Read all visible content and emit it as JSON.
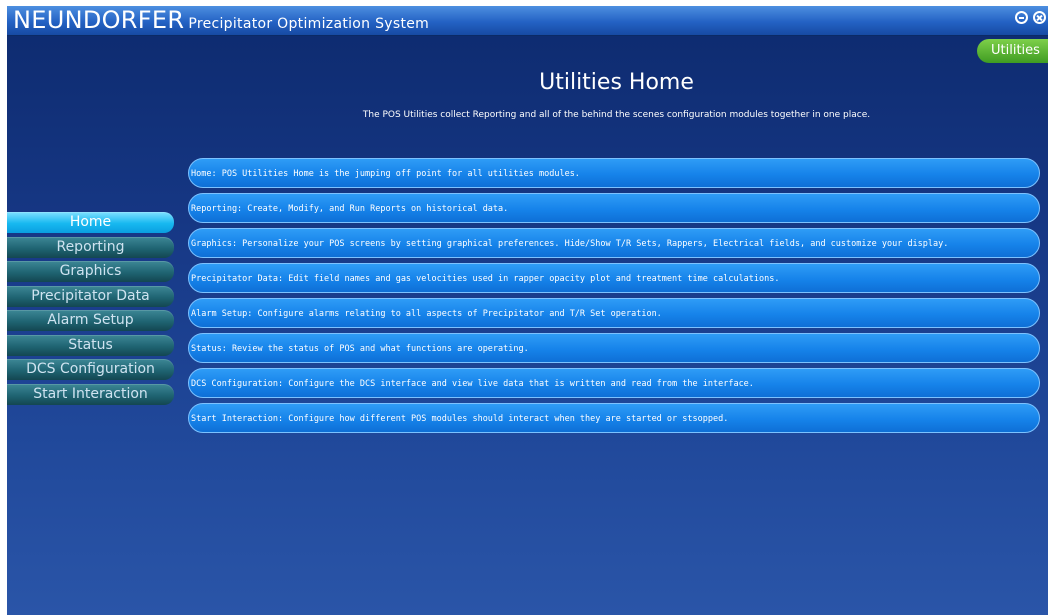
{
  "titlebar": {
    "brand": "NEUNDORFER",
    "subtitle": "Precipitator Optimization System",
    "minimize_icon": "minimize-circle-icon",
    "close_icon": "close-circle-icon"
  },
  "active_tab": "Utilities",
  "page": {
    "title": "Utilities Home",
    "description": "The POS Utilities collect Reporting and all of the behind the scenes configuration modules together in one place."
  },
  "sidebar": {
    "items": [
      {
        "label": "Home",
        "active": true
      },
      {
        "label": "Reporting",
        "active": false
      },
      {
        "label": "Graphics",
        "active": false
      },
      {
        "label": "Precipitator Data",
        "active": false
      },
      {
        "label": "Alarm Setup",
        "active": false
      },
      {
        "label": "Status",
        "active": false
      },
      {
        "label": "DCS Configuration",
        "active": false
      },
      {
        "label": "Start Interaction",
        "active": false
      }
    ]
  },
  "modules": [
    "Home: POS Utilities Home is the jumping off point for all utilities modules.",
    "Reporting: Create, Modify, and Run Reports on historical data.",
    "Graphics: Personalize your POS screens by setting graphical preferences. Hide/Show T/R Sets, Rappers, Electrical fields, and customize your display.",
    "Precipitator Data: Edit field names and gas velocities used in rapper opacity plot and treatment time calculations.",
    "Alarm Setup: Configure alarms relating to all aspects of Precipitator and T/R Set operation.",
    "Status: Review the status of POS and what functions are operating.",
    "DCS Configuration: Configure the DCS interface and view live data that is written and read from the interface.",
    "Start Interaction: Configure how different POS modules should interact when they are started or stsopped."
  ],
  "colors": {
    "accent_tab": "#3f9c22",
    "nav_active": "#17b8f0",
    "module_pill": "#1683ea"
  }
}
